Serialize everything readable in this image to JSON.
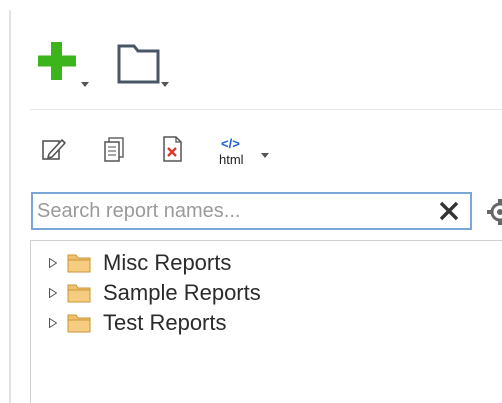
{
  "toolbar_main": {
    "new_icon": "plus-dropdown-icon",
    "folder_icon": "folder-dropdown-icon",
    "accent_green": "#3cb51c"
  },
  "toolbar_secondary": {
    "edit_icon": "edit-icon",
    "copy_icon": "copy-icon",
    "delete_icon": "delete-icon",
    "html_label": "html",
    "html_code_label": "</>",
    "html_accent": "#1a5fd6"
  },
  "search": {
    "placeholder": "Search report names...",
    "value": "",
    "clear_icon": "close-icon",
    "settings_icon": "gear-icon"
  },
  "tree": {
    "items": [
      {
        "label": "Misc Reports",
        "icon": "folder-icon",
        "expanded": false
      },
      {
        "label": "Sample Reports",
        "icon": "folder-icon",
        "expanded": false
      },
      {
        "label": "Test Reports",
        "icon": "folder-icon",
        "expanded": false
      }
    ]
  }
}
